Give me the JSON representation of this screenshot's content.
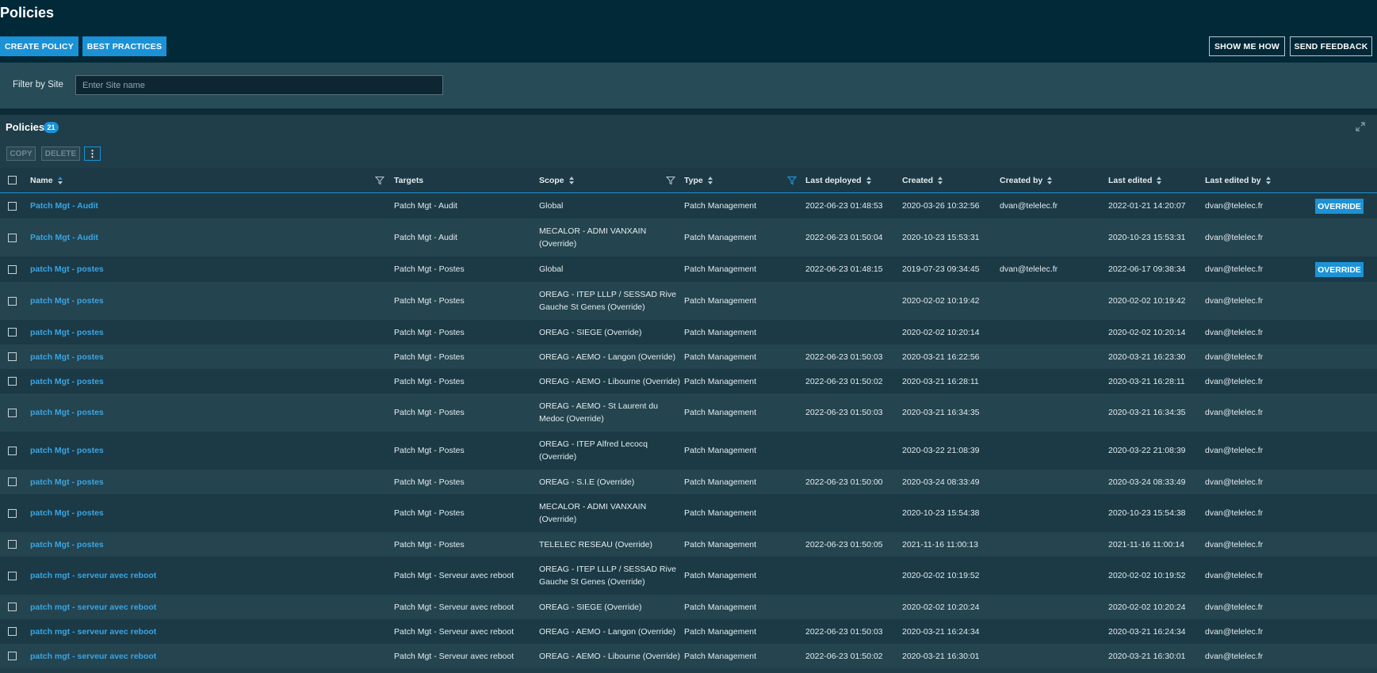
{
  "page_title": "Policies",
  "toolbar": {
    "create_policy": "CREATE POLICY",
    "best_practices": "BEST PRACTICES",
    "show_me_how": "SHOW ME HOW",
    "send_feedback": "SEND FEEDBACK"
  },
  "filter": {
    "label": "Filter by Site",
    "placeholder": "Enter Site name"
  },
  "section": {
    "title": "Policies",
    "count": "21",
    "copy_label": "COPY",
    "delete_label": "DELETE",
    "more_label": "⋮"
  },
  "columns": {
    "name": "Name",
    "targets": "Targets",
    "scope": "Scope",
    "type": "Type",
    "last_deployed": "Last deployed",
    "created": "Created",
    "created_by": "Created by",
    "last_edited": "Last edited",
    "last_edited_by": "Last edited by"
  },
  "override_label": "OVERRIDE",
  "rows": [
    {
      "name": "Patch Mgt - Audit",
      "targets": "Patch Mgt - Audit",
      "scope": "Global",
      "type": "Patch Management",
      "last_deployed": "2022-06-23 01:48:53",
      "created": "2020-03-26 10:32:56",
      "created_by": "dvan@telelec.fr",
      "last_edited": "2022-01-21 14:20:07",
      "last_edited_by": "dvan@telelec.fr",
      "override": true
    },
    {
      "name": "Patch Mgt - Audit",
      "targets": "Patch Mgt - Audit",
      "scope": "MECALOR - ADMI VANXAIN (Override)",
      "type": "Patch Management",
      "last_deployed": "2022-06-23 01:50:04",
      "created": "2020-10-23 15:53:31",
      "created_by": "",
      "last_edited": "2020-10-23 15:53:31",
      "last_edited_by": "dvan@telelec.fr",
      "override": false
    },
    {
      "name": "patch Mgt - postes",
      "targets": "Patch Mgt - Postes",
      "scope": "Global",
      "type": "Patch Management",
      "last_deployed": "2022-06-23 01:48:15",
      "created": "2019-07-23 09:34:45",
      "created_by": "dvan@telelec.fr",
      "last_edited": "2022-06-17 09:38:34",
      "last_edited_by": "dvan@telelec.fr",
      "override": true
    },
    {
      "name": "patch Mgt - postes",
      "targets": "Patch Mgt - Postes",
      "scope": "OREAG - ITEP LLLP / SESSAD Rive Gauche St Genes (Override)",
      "type": "Patch Management",
      "last_deployed": "",
      "created": "2020-02-02 10:19:42",
      "created_by": "",
      "last_edited": "2020-02-02 10:19:42",
      "last_edited_by": "dvan@telelec.fr",
      "override": false
    },
    {
      "name": "patch Mgt - postes",
      "targets": "Patch Mgt - Postes",
      "scope": "OREAG - SIEGE (Override)",
      "type": "Patch Management",
      "last_deployed": "",
      "created": "2020-02-02 10:20:14",
      "created_by": "",
      "last_edited": "2020-02-02 10:20:14",
      "last_edited_by": "dvan@telelec.fr",
      "override": false
    },
    {
      "name": "patch Mgt - postes",
      "targets": "Patch Mgt - Postes",
      "scope": "OREAG - AEMO - Langon (Override)",
      "type": "Patch Management",
      "last_deployed": "2022-06-23 01:50:03",
      "created": "2020-03-21 16:22:56",
      "created_by": "",
      "last_edited": "2020-03-21 16:23:30",
      "last_edited_by": "dvan@telelec.fr",
      "override": false
    },
    {
      "name": "patch Mgt - postes",
      "targets": "Patch Mgt - Postes",
      "scope": "OREAG - AEMO - Libourne (Override)",
      "type": "Patch Management",
      "last_deployed": "2022-06-23 01:50:02",
      "created": "2020-03-21 16:28:11",
      "created_by": "",
      "last_edited": "2020-03-21 16:28:11",
      "last_edited_by": "dvan@telelec.fr",
      "override": false
    },
    {
      "name": "patch Mgt - postes",
      "targets": "Patch Mgt - Postes",
      "scope": "OREAG - AEMO - St Laurent du Medoc (Override)",
      "type": "Patch Management",
      "last_deployed": "2022-06-23 01:50:03",
      "created": "2020-03-21 16:34:35",
      "created_by": "",
      "last_edited": "2020-03-21 16:34:35",
      "last_edited_by": "dvan@telelec.fr",
      "override": false
    },
    {
      "name": "patch Mgt - postes",
      "targets": "Patch Mgt - Postes",
      "scope": "OREAG - ITEP Alfred Lecocq (Override)",
      "type": "Patch Management",
      "last_deployed": "",
      "created": "2020-03-22 21:08:39",
      "created_by": "",
      "last_edited": "2020-03-22 21:08:39",
      "last_edited_by": "dvan@telelec.fr",
      "override": false
    },
    {
      "name": "patch Mgt - postes",
      "targets": "Patch Mgt - Postes",
      "scope": "OREAG - S.I.E (Override)",
      "type": "Patch Management",
      "last_deployed": "2022-06-23 01:50:00",
      "created": "2020-03-24 08:33:49",
      "created_by": "",
      "last_edited": "2020-03-24 08:33:49",
      "last_edited_by": "dvan@telelec.fr",
      "override": false
    },
    {
      "name": "patch Mgt - postes",
      "targets": "Patch Mgt - Postes",
      "scope": "MECALOR - ADMI VANXAIN (Override)",
      "type": "Patch Management",
      "last_deployed": "",
      "created": "2020-10-23 15:54:38",
      "created_by": "",
      "last_edited": "2020-10-23 15:54:38",
      "last_edited_by": "dvan@telelec.fr",
      "override": false
    },
    {
      "name": "patch Mgt - postes",
      "targets": "Patch Mgt - Postes",
      "scope": "TELELEC RESEAU (Override)",
      "type": "Patch Management",
      "last_deployed": "2022-06-23 01:50:05",
      "created": "2021-11-16 11:00:13",
      "created_by": "",
      "last_edited": "2021-11-16 11:00:14",
      "last_edited_by": "dvan@telelec.fr",
      "override": false
    },
    {
      "name": "patch mgt - serveur avec reboot",
      "targets": "Patch Mgt - Serveur avec reboot",
      "scope": "OREAG - ITEP LLLP / SESSAD Rive Gauche St Genes (Override)",
      "type": "Patch Management",
      "last_deployed": "",
      "created": "2020-02-02 10:19:52",
      "created_by": "",
      "last_edited": "2020-02-02 10:19:52",
      "last_edited_by": "dvan@telelec.fr",
      "override": false
    },
    {
      "name": "patch mgt - serveur avec reboot",
      "targets": "Patch Mgt - Serveur avec reboot",
      "scope": "OREAG - SIEGE (Override)",
      "type": "Patch Management",
      "last_deployed": "",
      "created": "2020-02-02 10:20:24",
      "created_by": "",
      "last_edited": "2020-02-02 10:20:24",
      "last_edited_by": "dvan@telelec.fr",
      "override": false
    },
    {
      "name": "patch mgt - serveur avec reboot",
      "targets": "Patch Mgt - Serveur avec reboot",
      "scope": "OREAG - AEMO - Langon (Override)",
      "type": "Patch Management",
      "last_deployed": "2022-06-23 01:50:03",
      "created": "2020-03-21 16:24:34",
      "created_by": "",
      "last_edited": "2020-03-21 16:24:34",
      "last_edited_by": "dvan@telelec.fr",
      "override": false
    },
    {
      "name": "patch mgt - serveur avec reboot",
      "targets": "Patch Mgt - Serveur avec reboot",
      "scope": "OREAG - AEMO - Libourne (Override)",
      "type": "Patch Management",
      "last_deployed": "2022-06-23 01:50:02",
      "created": "2020-03-21 16:30:01",
      "created_by": "",
      "last_edited": "2020-03-21 16:30:01",
      "last_edited_by": "dvan@telelec.fr",
      "override": false
    }
  ]
}
